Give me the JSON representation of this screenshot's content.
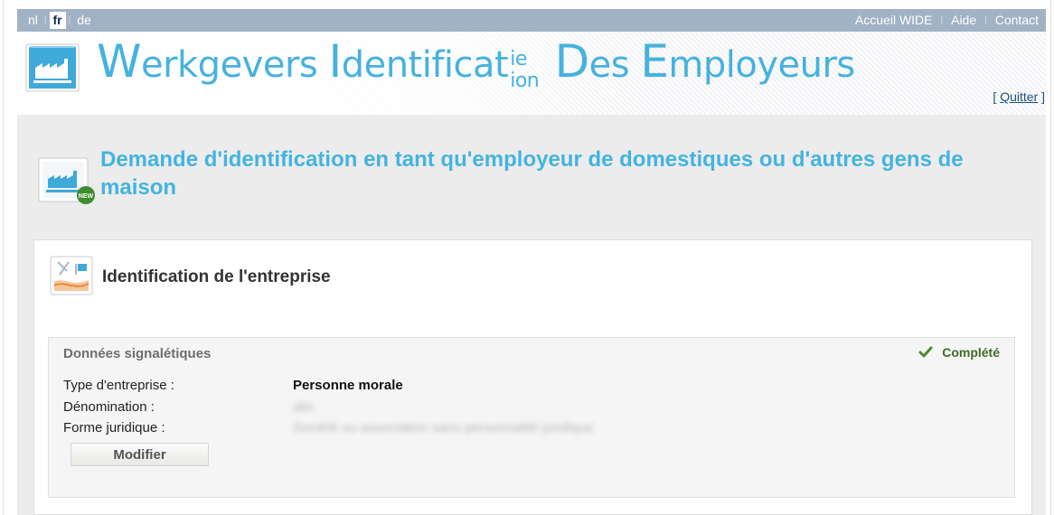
{
  "topnav": {
    "languages": [
      {
        "code": "nl",
        "active": false
      },
      {
        "code": "fr",
        "active": true
      },
      {
        "code": "de",
        "active": false
      }
    ],
    "links": [
      "Accueil WIDE",
      "Aide",
      "Contact"
    ]
  },
  "banner": {
    "title_part1_cap": "W",
    "title_part1": "erkgevers ",
    "title_part2_cap": "I",
    "title_part2": "dentificat",
    "title_sup": "ie",
    "title_sub": "ion",
    "title_part3_cap": " D",
    "title_part3": "es ",
    "title_part4_cap": "E",
    "title_part4": "mployeurs",
    "quit_open": "[ ",
    "quit_label": "Quitter",
    "quit_close": " ]"
  },
  "page": {
    "title": "Demande d'identification en tant qu'employeur de domestiques ou d'autres gens de maison"
  },
  "section": {
    "title": "Identification de l'entreprise",
    "box_title": "Données signalétiques",
    "status": "Complété",
    "fields": [
      {
        "label": "Type d'entreprise :",
        "value": "Personne morale"
      },
      {
        "label": "Dénomination :",
        "value": "abc"
      },
      {
        "label": "Forme juridique :",
        "value": "Société ou association sans personnalité juridique"
      }
    ],
    "modify_button": "Modifier"
  },
  "colors": {
    "nav_bar": "#a1b2c5",
    "brand_blue": "#46b2de",
    "content_bg": "#ececec",
    "status_green": "#3f6b2a"
  },
  "icons": {
    "logo": "factory-icon",
    "page": "factory-new-icon",
    "section": "map-document-icon",
    "status": "checkmark-icon"
  }
}
